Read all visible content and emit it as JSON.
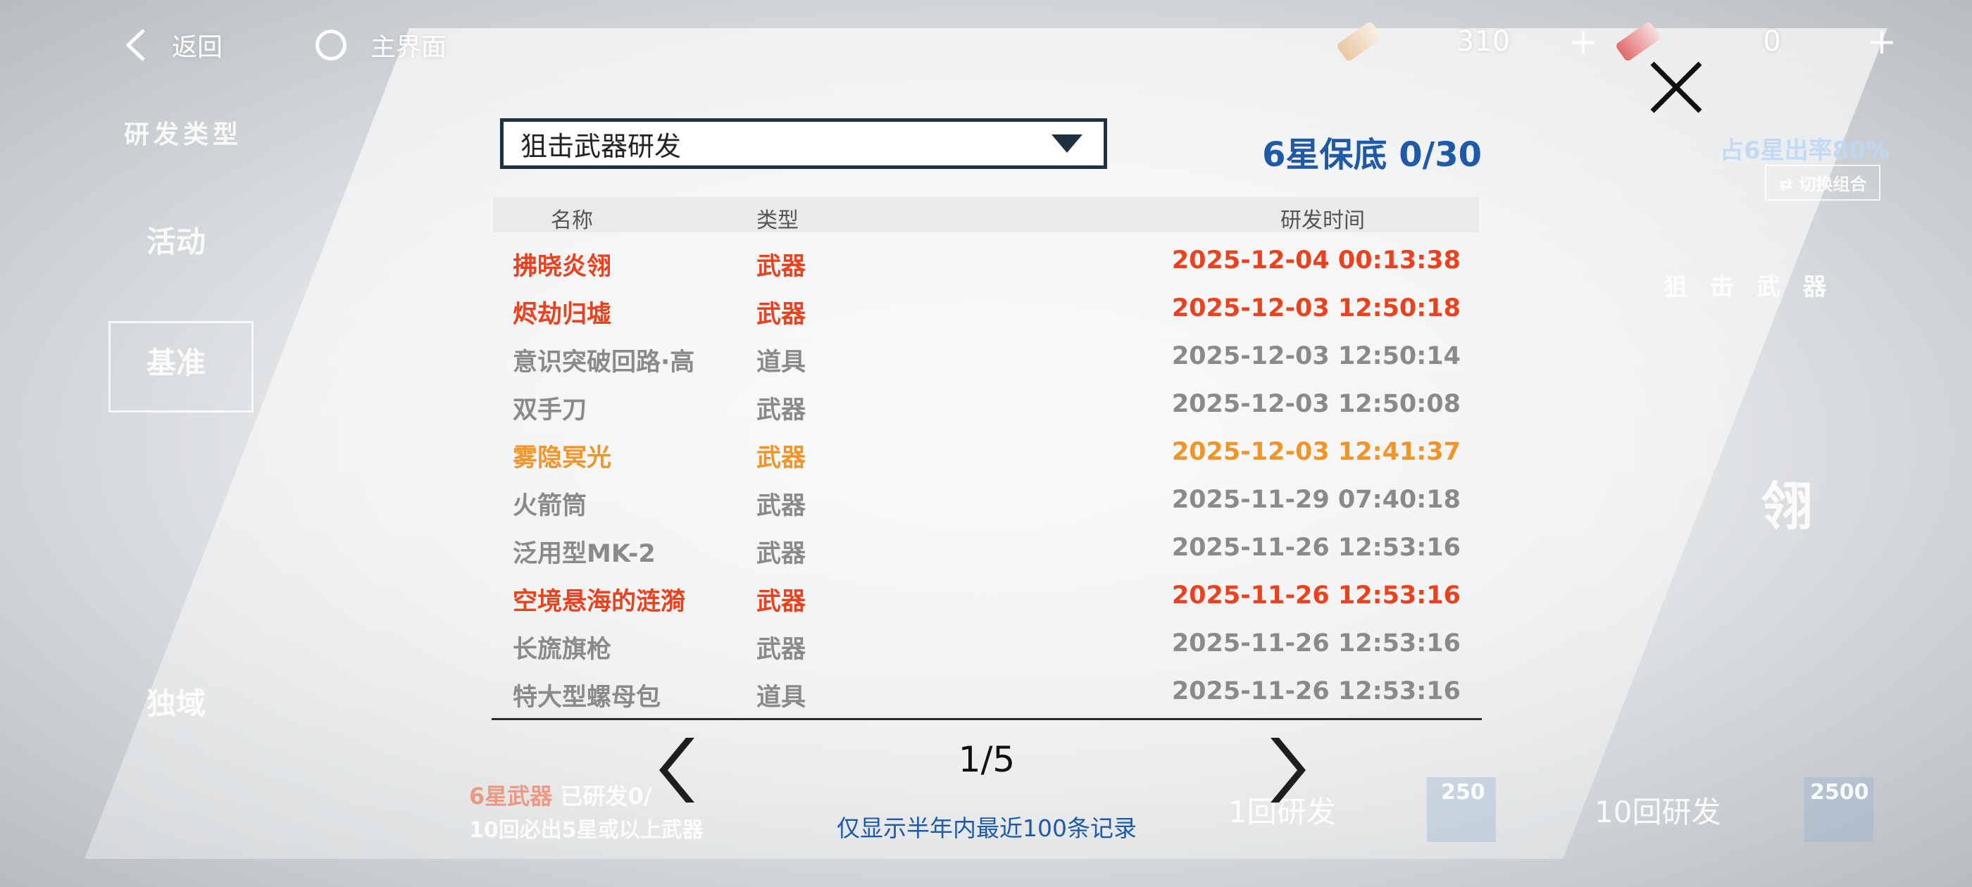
{
  "topbar": {
    "back_label": "返回",
    "home_label": "主界面",
    "currency1_value": "310",
    "currency2_value": "0",
    "plus": "+"
  },
  "background": {
    "section_title": "研发类型",
    "tab_active": "活动",
    "tab_standard": "基准",
    "tab_exclusive": "独域",
    "banner_rate": "占6星出率80%",
    "switch_combo": "切换组合",
    "right_title": "狙 击 武 器",
    "right_big": "翎",
    "pity_line1_prefix": "6星武器",
    "pity_line1_suffix": "已研发0/",
    "pity_line2": "10回必出5星或以上武器",
    "one_pull": "1回研发",
    "one_cost": "250",
    "ten_pull": "10回研发",
    "ten_cost": "2500"
  },
  "modal": {
    "dropdown_value": "狙击武器研发",
    "pity_text": "6星保底 0/30",
    "headers": {
      "name": "名称",
      "type": "类型",
      "time": "研发时间"
    },
    "records": [
      {
        "name": "拂晓炎翎",
        "type": "武器",
        "time": "2025-12-04 00:13:38",
        "color": "#e8421e"
      },
      {
        "name": "烬劫归墟",
        "type": "武器",
        "time": "2025-12-03 12:50:18",
        "color": "#e8421e"
      },
      {
        "name": "意识突破回路·高",
        "type": "道具",
        "time": "2025-12-03 12:50:14",
        "color": "#8a8a8a"
      },
      {
        "name": "双手刀",
        "type": "武器",
        "time": "2025-12-03 12:50:08",
        "color": "#8a8a8a"
      },
      {
        "name": "雾隐冥光",
        "type": "武器",
        "time": "2025-12-03 12:41:37",
        "color": "#f0952a"
      },
      {
        "name": "火箭筒",
        "type": "武器",
        "time": "2025-11-29 07:40:18",
        "color": "#8a8a8a"
      },
      {
        "name": "泛用型MK-2",
        "type": "武器",
        "time": "2025-11-26 12:53:16",
        "color": "#8a8a8a"
      },
      {
        "name": "空境悬海的涟漪",
        "type": "武器",
        "time": "2025-11-26 12:53:16",
        "color": "#e8421e"
      },
      {
        "name": "长旒旗枪",
        "type": "武器",
        "time": "2025-11-26 12:53:16",
        "color": "#8a8a8a"
      },
      {
        "name": "特大型螺母包",
        "type": "道具",
        "time": "2025-11-26 12:53:16",
        "color": "#8a8a8a"
      }
    ],
    "page_indicator": "1/5",
    "note": "仅显示半年内最近100条记录"
  },
  "colors": {
    "accent_blue": "#1f5aa8",
    "rarity_red": "#e8421e",
    "rarity_orange": "#f0952a",
    "common_gray": "#8a8a8a"
  },
  "icons": {
    "back": "chevron-left-icon",
    "home": "ring-icon",
    "close": "close-icon",
    "prev": "chevron-left-icon",
    "next": "chevron-right-icon",
    "dropdown": "triangle-down-icon"
  }
}
